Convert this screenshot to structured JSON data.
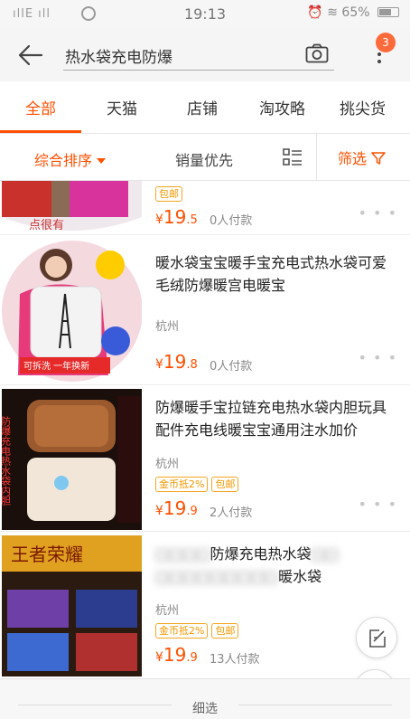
{
  "status_bar": {
    "signal": "ıllE ıll",
    "time": "19:13",
    "battery": "65%"
  },
  "search": {
    "query": "热水袋充电防爆",
    "notification_count": "3"
  },
  "tabs": [
    {
      "label": "全部",
      "active": true
    },
    {
      "label": "天猫",
      "active": false
    },
    {
      "label": "店铺",
      "active": false
    },
    {
      "label": "淘攻略",
      "active": false
    },
    {
      "label": "挑尖货",
      "active": false
    }
  ],
  "sort": {
    "comprehensive": "综合排序",
    "sales_first": "销量优先",
    "filter": "筛选"
  },
  "products": [
    {
      "title": "",
      "location": "",
      "tags": [
        "包邮"
      ],
      "price_currency": "¥",
      "price_int": "19",
      "price_dec": ".5",
      "buyers": "0人付款",
      "thumb_text": "点很有"
    },
    {
      "title": "暖水袋宝宝暖手宝充电式热水袋可爱毛绒防爆暖宫电暖宝",
      "location": "杭州",
      "tags": [],
      "price_currency": "¥",
      "price_int": "19",
      "price_dec": ".8",
      "buyers": "0人付款",
      "thumb_text": "可拆洗 一年换新"
    },
    {
      "title": "防爆暖手宝拉链充电热水袋内胆玩具配件充电线暖宝宝通用注水加价",
      "location": "杭州",
      "tags": [
        "金币抵2%",
        "包邮"
      ],
      "price_currency": "¥",
      "price_int": "19",
      "price_dec": ".9",
      "buyers": "2人付款",
      "thumb_text": "防爆充电热水袋内胆"
    },
    {
      "title_visible": "防爆充电热水袋",
      "title_line2_visible": "暖水袋",
      "location": "杭州",
      "tags": [
        "金币抵2%",
        "包邮"
      ],
      "price_currency": "¥",
      "price_int": "19",
      "price_dec": ".9",
      "buyers": "13人付款",
      "thumb_text": "王者荣耀"
    }
  ],
  "bottom_bar": {
    "label": "细选"
  },
  "colors": {
    "accent": "#ff5000",
    "tag_orange": "#f39800",
    "badge": "#ff6a3a"
  }
}
